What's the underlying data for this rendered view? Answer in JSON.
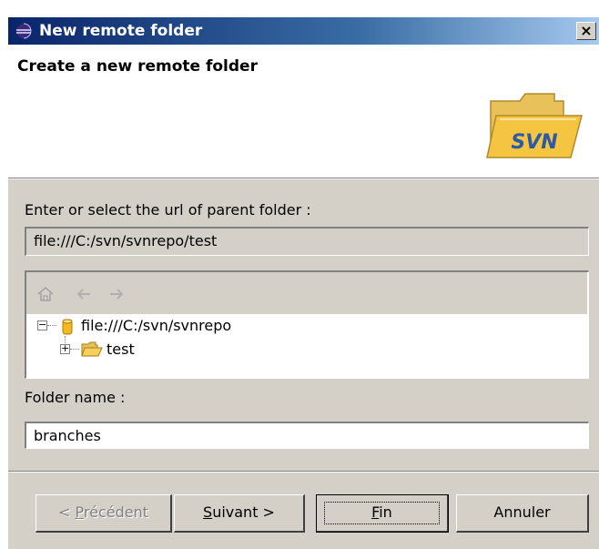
{
  "window": {
    "title": "New remote folder",
    "close_label": "×"
  },
  "banner": {
    "title": "Create a new remote folder",
    "image_text": "SVN"
  },
  "url_section": {
    "label": "Enter or select the url of parent folder :",
    "value": "file:///C:/svn/svnrepo/test"
  },
  "tree": {
    "toolbar_icons": [
      "home-icon",
      "back-arrow-icon",
      "forward-arrow-icon"
    ],
    "root": {
      "label": "file:///C:/svn/svnrepo",
      "expander": "−",
      "icon": "repository-icon"
    },
    "child": {
      "label": "test",
      "expander": "+",
      "icon": "open-folder-icon"
    }
  },
  "folder_name": {
    "label": "Folder name :",
    "value": "branches"
  },
  "buttons": {
    "back": {
      "prefix": "< ",
      "mnemonic": "P",
      "rest": "récédent",
      "enabled": false
    },
    "next": {
      "prefix": "",
      "mnemonic": "S",
      "rest": "uivant >",
      "enabled": true
    },
    "finish": {
      "prefix": "",
      "mnemonic": "F",
      "rest": "in",
      "enabled": true,
      "default": true
    },
    "cancel": {
      "label": "Annuler",
      "enabled": true
    }
  },
  "colors": {
    "titlebar_start": "#0a246a",
    "titlebar_end": "#a6caf0",
    "dialog_bg": "#d4d0c8",
    "folder_yellow": "#f5c542",
    "svn_blue": "#2d5aa6"
  }
}
